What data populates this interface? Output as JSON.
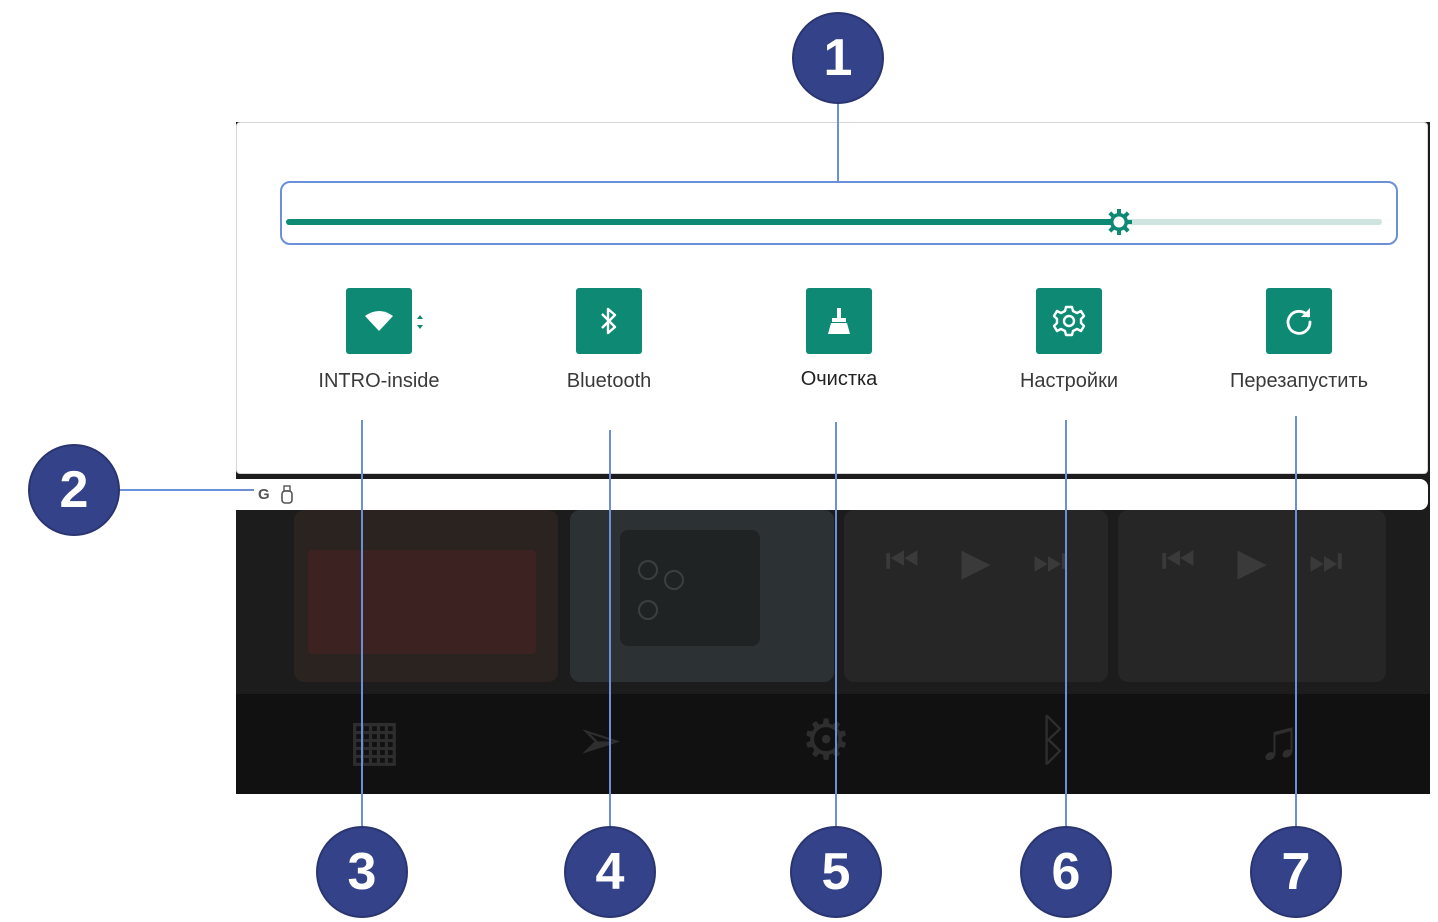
{
  "slider": {
    "level": 0.76,
    "thumb_icon": "brightness-gear-icon"
  },
  "status_bar": {
    "google_letter": "G",
    "usb_icon": "usb-icon"
  },
  "tiles": [
    {
      "label": "INTRO-inside",
      "icon": "wifi-icon"
    },
    {
      "label": "Bluetooth",
      "icon": "bluetooth-icon"
    },
    {
      "label": "Очистка",
      "icon": "broom-icon"
    },
    {
      "label": "Настройки",
      "icon": "gear-icon"
    },
    {
      "label": "Перезапустить",
      "icon": "restart-icon"
    }
  ],
  "callouts": [
    "1",
    "2",
    "3",
    "4",
    "5",
    "6",
    "7"
  ],
  "colors": {
    "accent": "#0e8a74",
    "callout": "#34428a",
    "callout_line": "#6b8fd8"
  }
}
